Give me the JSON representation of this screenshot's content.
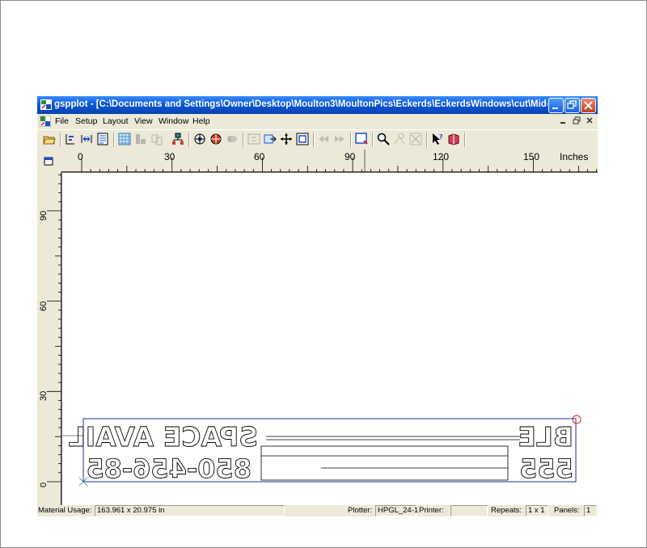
{
  "window": {
    "title": "gspplot - [C:\\Documents and Settings\\Owner\\Desktop\\Moulton3\\MoultonPics\\Eckerds\\EckerdsWindows\\cut\\Midd..."
  },
  "menu": {
    "items": [
      {
        "label": "File"
      },
      {
        "label": "Setup"
      },
      {
        "label": "Layout"
      },
      {
        "label": "View"
      },
      {
        "label": "Window"
      },
      {
        "label": "Help"
      }
    ]
  },
  "ruler": {
    "unit": "Inches",
    "top_labels": [
      "0",
      "30",
      "60",
      "90",
      "120",
      "150"
    ],
    "left_labels": [
      "90",
      "60",
      "30",
      "0"
    ]
  },
  "canvas": {
    "text_row1": "SPACE AVAIL",
    "text_row1_right": "BLE",
    "text_row2": "850-456-8",
    "text_row2_left": "5",
    "text_row2_right": "555"
  },
  "status": {
    "material_label": "Material Usage:",
    "material_value": "163.961 x 20.975 in",
    "plotter_label": "Plotter:",
    "plotter_value": "HPGL_24-1",
    "printer_label": "Printer:",
    "printer_value": "",
    "repeats_label": "Repeats:",
    "repeats_value": "1 x 1",
    "panels_label": "Panels:",
    "panels_value": "1"
  },
  "colors": {
    "titlebar": "#0a58d8",
    "accent_blue": "#1c2fa0",
    "marker_red": "#e02020"
  },
  "icons": {
    "toolbar": [
      "open-icon",
      "align-left-icon",
      "align-center-icon",
      "properties-icon",
      "grid-icon",
      "layout-icon",
      "copy-icon",
      "network-icon",
      "plot-icon",
      "plot-options-icon",
      "color-icon",
      "panel-icon",
      "move-icon",
      "pan-icon",
      "fit-icon",
      "rewind-icon",
      "forward-icon",
      "preview-icon",
      "zoom-icon",
      "weed-icon",
      "cancel-icon",
      "help-icon",
      "book-icon"
    ]
  }
}
